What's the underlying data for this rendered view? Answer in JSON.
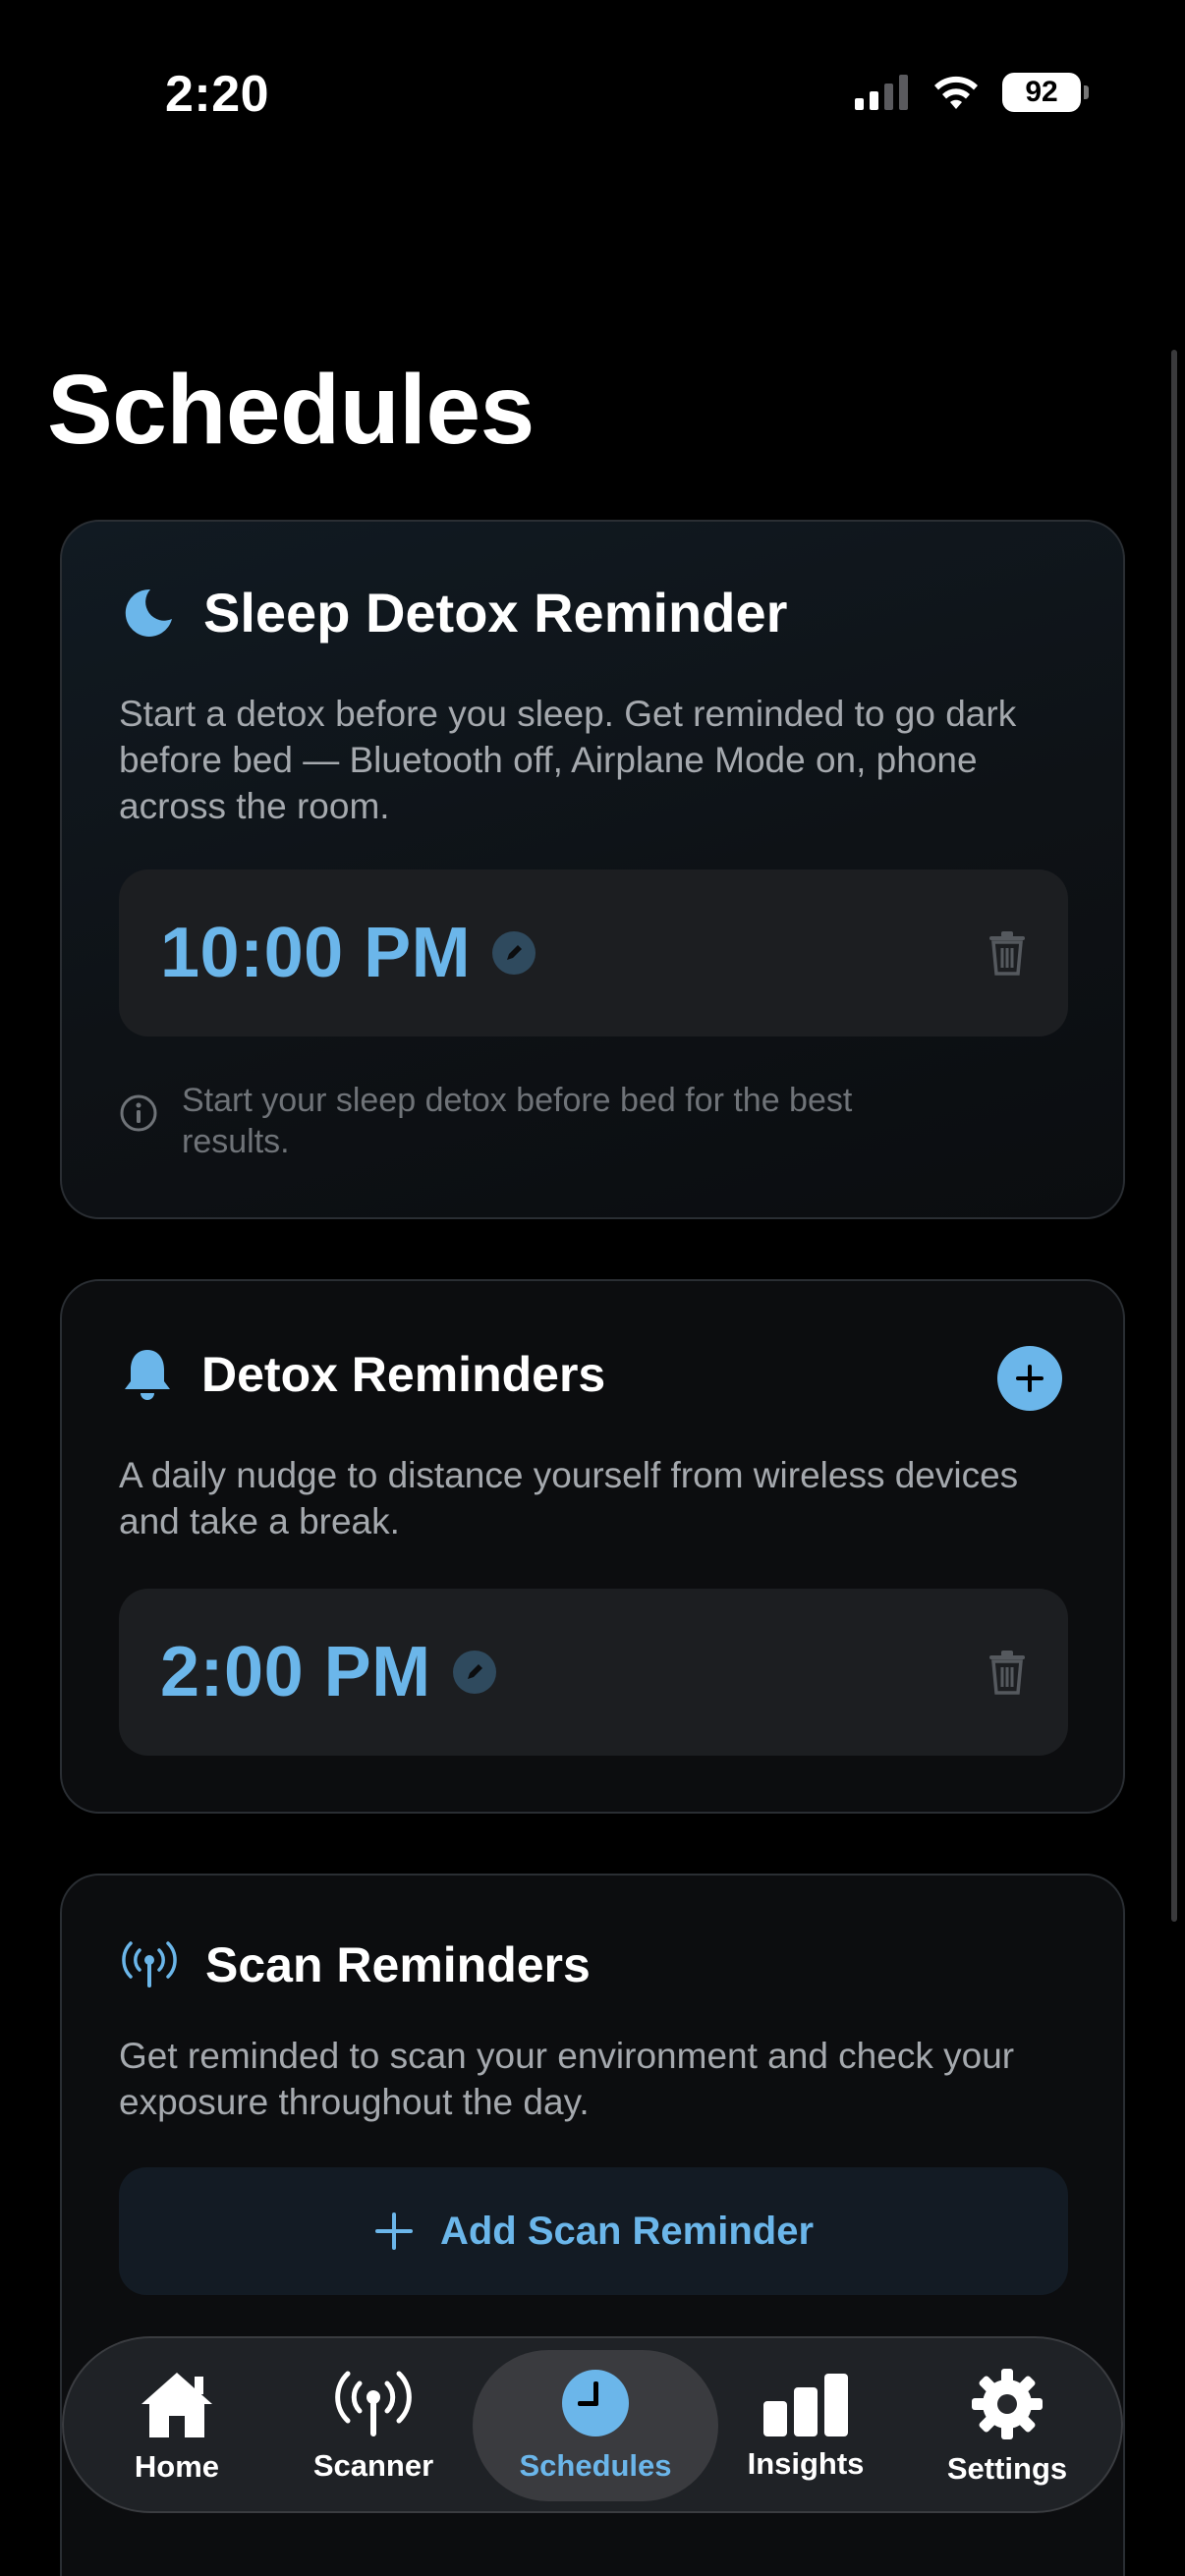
{
  "status_bar": {
    "time": "2:20",
    "battery": "92"
  },
  "page": {
    "title": "Schedules"
  },
  "sleep_card": {
    "title": "Sleep Detox Reminder",
    "description": "Start a detox before you sleep. Get reminded to go dark before bed — Bluetooth off, Airplane Mode on, phone across the room.",
    "time": "10:00 PM",
    "info": "Start your sleep detox before bed for the best results.",
    "icon": "moon-icon"
  },
  "detox_card": {
    "title": "Detox Reminders",
    "description": "A daily nudge to distance yourself from wireless devices and take a break.",
    "time": "2:00 PM",
    "icon": "bell-icon"
  },
  "scan_card": {
    "title": "Scan Reminders",
    "description": "Get reminded to scan your environment and check your exposure throughout the day.",
    "add_button": "Add Scan Reminder",
    "icon": "antenna-icon"
  },
  "tab_bar": {
    "tabs": [
      {
        "label": "Home",
        "icon": "house-icon"
      },
      {
        "label": "Scanner",
        "icon": "antenna-icon"
      },
      {
        "label": "Schedules",
        "icon": "clock-icon",
        "active": true
      },
      {
        "label": "Insights",
        "icon": "bar-chart-icon"
      },
      {
        "label": "Settings",
        "icon": "gear-icon"
      }
    ]
  },
  "colors": {
    "accent": "#6bb6ea",
    "background": "#000000",
    "card": "#0c0d0f"
  }
}
